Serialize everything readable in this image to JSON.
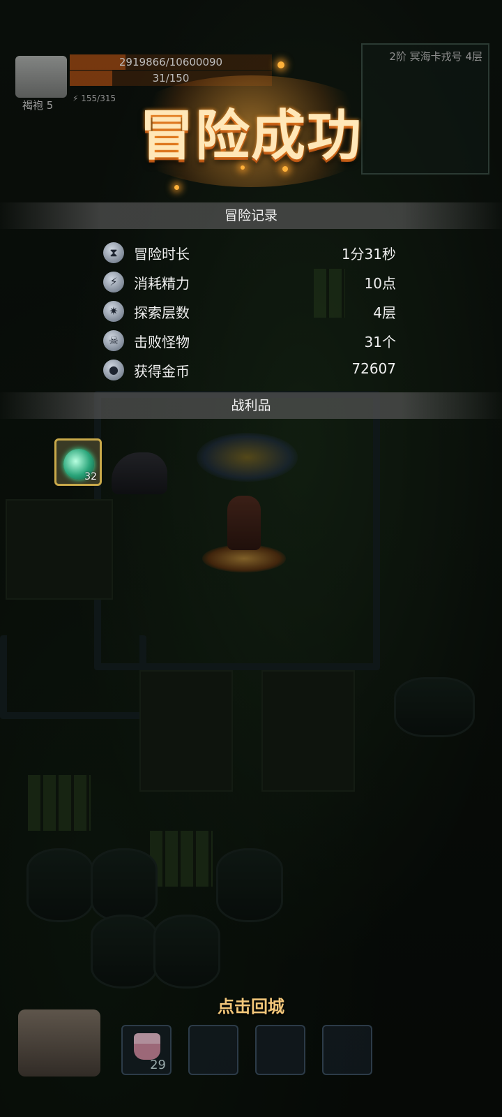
{
  "hud": {
    "avatar_name": "褐袍 5",
    "hp_text": "2919866/10600090",
    "hp_fraction": 0.275,
    "mp_text": "31/150",
    "mp_fraction": 0.21,
    "energy_text": "155/315",
    "minimap_label": "2阶 冥海卡戎号 4层"
  },
  "title": "冒险成功",
  "record": {
    "header": "冒险记录",
    "rows": [
      {
        "icon": "hourglass-icon",
        "label": "冒险时长",
        "value": "1分31秒"
      },
      {
        "icon": "lightning-icon",
        "label": "消耗精力",
        "value": "10点"
      },
      {
        "icon": "compass-icon",
        "label": "探索层数",
        "value": "4层"
      },
      {
        "icon": "skull-icon",
        "label": "击败怪物",
        "value": "31个"
      },
      {
        "icon": "coin-icon",
        "label": "获得金币",
        "value": "72607"
      }
    ]
  },
  "loot": {
    "header": "战利品",
    "items": [
      {
        "icon": "green-potion-icon",
        "count": "32"
      }
    ]
  },
  "bottom": {
    "return_label": "点击回城",
    "slots": [
      {
        "icon": "cake-icon",
        "count": "29"
      },
      {
        "icon": "",
        "count": ""
      },
      {
        "icon": "",
        "count": ""
      },
      {
        "icon": "",
        "count": ""
      }
    ]
  }
}
